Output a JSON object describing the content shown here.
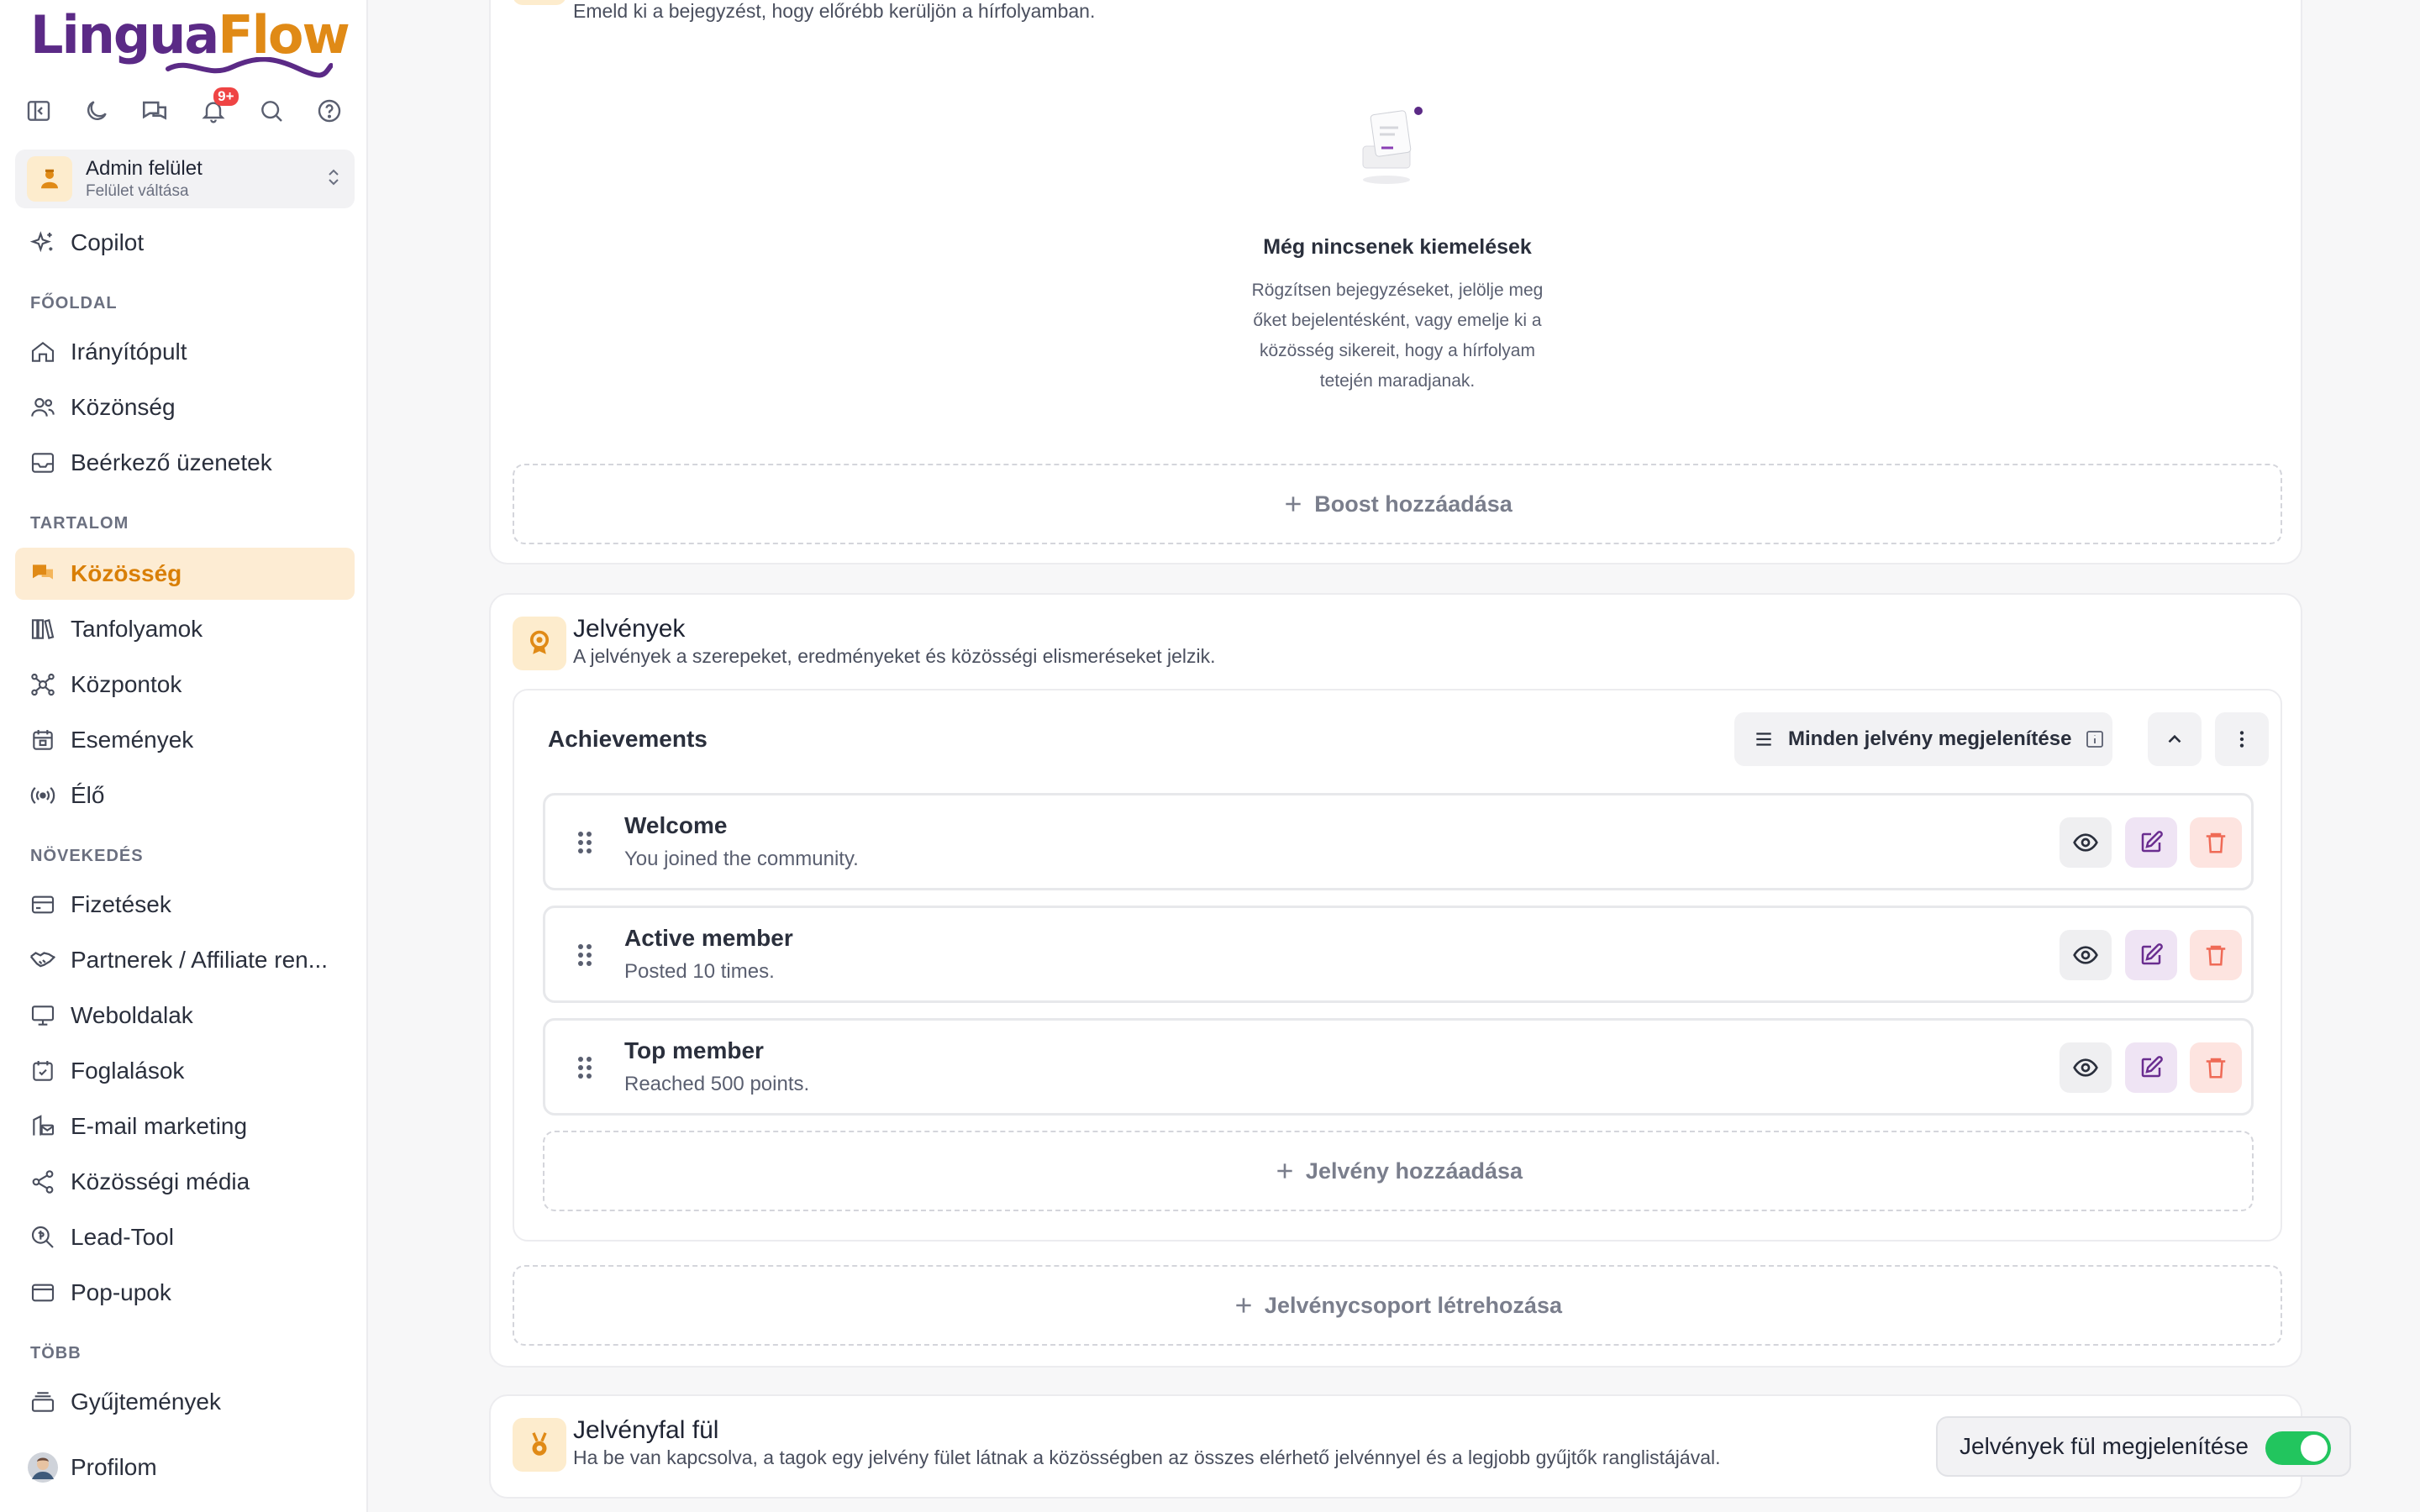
{
  "brand": {
    "name_part1": "Lingua",
    "name_part2": "Flow",
    "accent": "#e08a16",
    "primary": "#5b2a86"
  },
  "topbar": {
    "notification_badge": "9+"
  },
  "switcher": {
    "title": "Admin felület",
    "subtitle": "Felület váltása"
  },
  "nav": {
    "copilot": "Copilot",
    "sections": {
      "home": "FŐOLDAL",
      "content": "TARTALOM",
      "growth": "NÖVEKEDÉS",
      "more": "TÖBB"
    },
    "home_items": [
      "Irányítópult",
      "Közönség",
      "Beérkező üzenetek"
    ],
    "content_items": [
      "Közösség",
      "Tanfolyamok",
      "Központok",
      "Események",
      "Élő"
    ],
    "growth_items": [
      "Fizetések",
      "Partnerek / Affiliate ren...",
      "Weboldalak",
      "Foglalások",
      "E-mail marketing",
      "Közösségi média",
      "Lead-Tool",
      "Pop-upok"
    ],
    "more_items": [
      "Gyűjtemények",
      "Profilom"
    ],
    "active": "Közösség"
  },
  "highlights": {
    "subtitle": "Emeld ki a bejegyzést, hogy előrébb kerüljön a hírfolyamban.",
    "empty_title": "Még nincsenek kiemelések",
    "empty_lines": [
      "Rögzítsen bejegyzéseket, jelölje meg",
      "őket bejelentésként, vagy emelje ki a",
      "közösség sikereit, hogy a hírfolyam",
      "tetején maradjanak."
    ],
    "add_boost": "Boost hozzáadása"
  },
  "badges": {
    "title": "Jelvények",
    "subtitle": "A jelvények a szerepeket, eredményeket és közösségi elismeréseket jelzik.",
    "group": {
      "title": "Achievements",
      "show_all": "Minden jelvény megjelenítése",
      "items": [
        {
          "name": "Welcome",
          "desc": "You joined the community."
        },
        {
          "name": "Active member",
          "desc": "Posted 10 times."
        },
        {
          "name": "Top member",
          "desc": "Reached 500 points."
        }
      ],
      "add_badge": "Jelvény hozzáadása"
    },
    "create_group": "Jelvénycsoport létrehozása"
  },
  "badge_wall": {
    "title": "Jelvényfal fül",
    "subtitle": "Ha be van kapcsolva, a tagok egy jelvény fület látnak a közösségben az összes elérhető jelvénnyel és a legjobb gyűjtők ranglistájával.",
    "toggle_label": "Jelvények fül megjelenítése",
    "toggle_on": true
  }
}
